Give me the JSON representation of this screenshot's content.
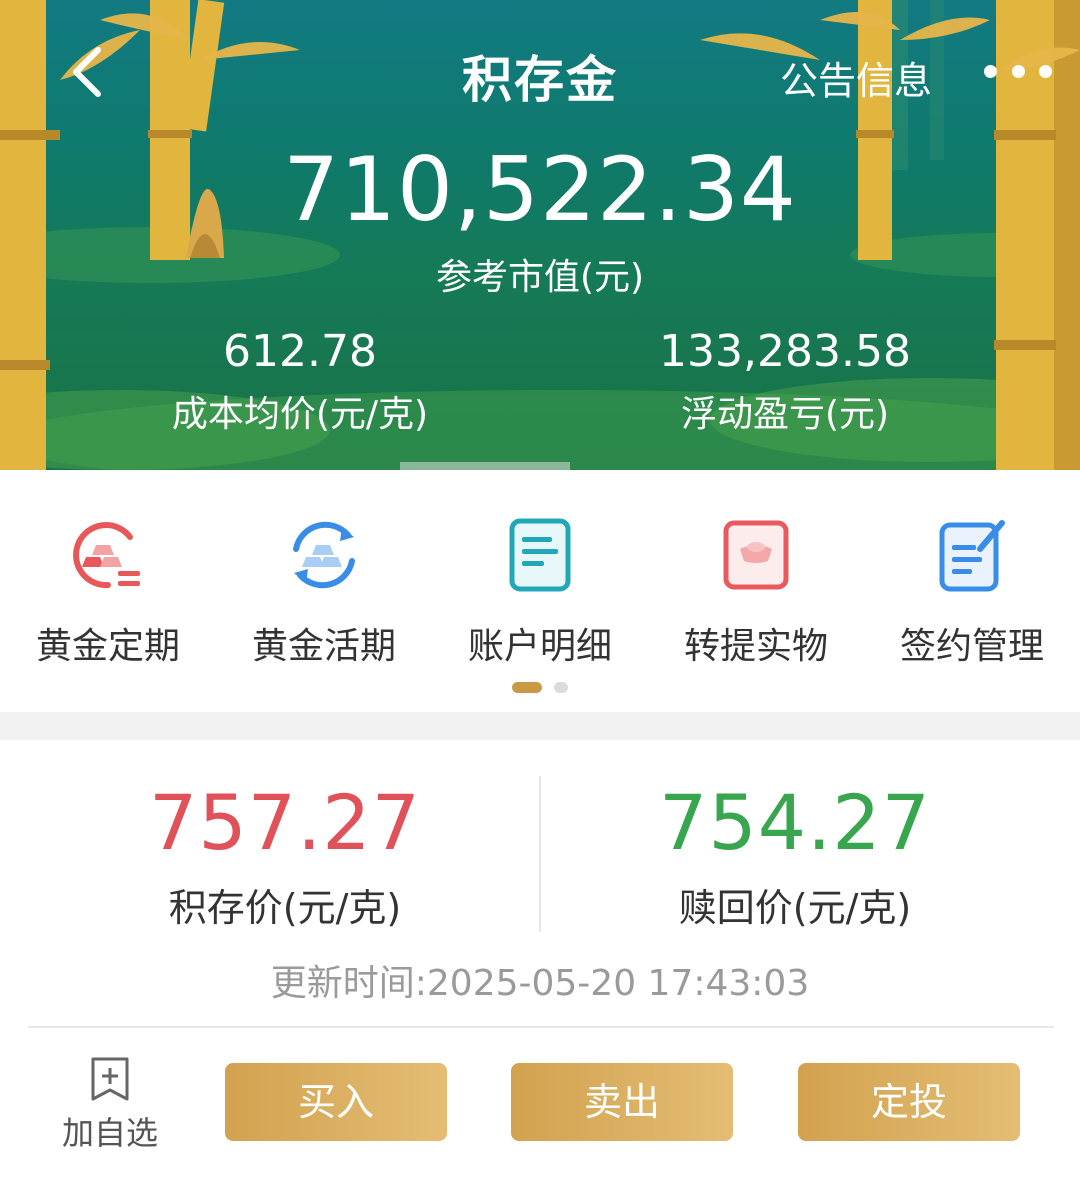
{
  "header": {
    "title": "积存金",
    "notice_label": "公告信息"
  },
  "summary": {
    "market_value": "710,522.34",
    "market_value_label": "参考市值(元)",
    "avg_cost": "612.78",
    "avg_cost_label": "成本均价(元/克)",
    "floating_pl": "133,283.58",
    "floating_pl_label": "浮动盈亏(元)"
  },
  "quick_menu": {
    "items": [
      {
        "label": "黄金定期",
        "icon": "gold-bars-list-icon",
        "color": "#e8585a"
      },
      {
        "label": "黄金活期",
        "icon": "gold-bars-cycle-icon",
        "color": "#3a8de6"
      },
      {
        "label": "账户明细",
        "icon": "document-lines-icon",
        "color": "#21a8b8"
      },
      {
        "label": "转提实物",
        "icon": "gold-ingot-box-icon",
        "color": "#e85a5e"
      },
      {
        "label": "签约管理",
        "icon": "edit-document-icon",
        "color": "#3a8de6"
      }
    ],
    "page_count": 2,
    "active_page": 1
  },
  "prices": {
    "deposit_price": "757.27",
    "deposit_price_label": "积存价(元/克)",
    "redeem_price": "754.27",
    "redeem_price_label": "赎回价(元/克)",
    "update_time": "更新时间:2025-05-20 17:43:03",
    "up_color": "#e0525a",
    "down_color": "#3aa54f"
  },
  "actions": {
    "favorite_label": "加自选",
    "buy_label": "买入",
    "sell_label": "卖出",
    "plan_label": "定投",
    "button_color": "#d6a554"
  }
}
